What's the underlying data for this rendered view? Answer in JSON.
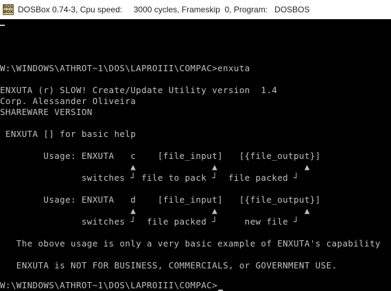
{
  "window": {
    "icon_text": "DOS BOX",
    "title": "DOSBox 0.74-3, Cpu speed:     3000 cycles, Frameskip  0, Program:   DOSBOS"
  },
  "terminal": {
    "colors": {
      "background": "#000000",
      "foreground": "#c0c0c0"
    },
    "lines": [
      "W:\\WINDOWS\\ATHROT~1\\DOS\\LAPROIII\\COMPAC>enxuta",
      "ENXUTA (r) SLOW! Create/Update Utility version  1.4",
      "Corp. Alessander Oliveira",
      "SHAREWARE VERSION",
      " ENXUTA [] for basic help",
      "        Usage: ENXUTA   c    [file_input]   [{file_output}]",
      "                        ▲              ▲                ▲",
      "               switches ┘ file to pack ┘  file packed ┘",
      "        Usage: ENXUTA   d    [file_input]   [{file_output}]",
      "                        ▲              ▲                ▲",
      "               switches ┘  file packed ┘     new file ┘",
      "   The obove usage is only a very basic example of ENXUTA's capability",
      "   ENXUTA is NOT FOR BUSINESS, COMMERCIALS, or GOVERNMENT USE.",
      "W:\\WINDOWS\\ATHROT~1\\DOS\\LAPROIII\\COMPAC>"
    ]
  }
}
